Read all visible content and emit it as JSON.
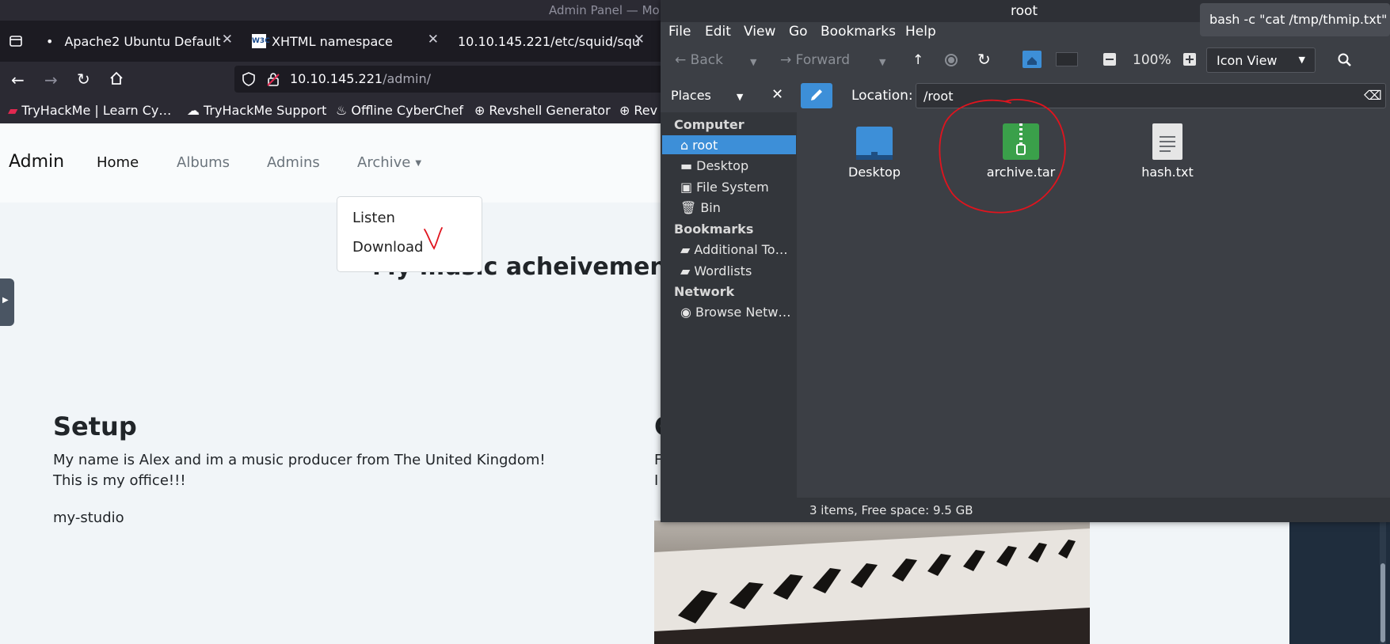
{
  "browser": {
    "window_title": "Admin Panel — Mo",
    "tabs": [
      {
        "label": "Apache2 Ubuntu Default",
        "icon": "bullet-icon"
      },
      {
        "label": "XHTML namespace",
        "icon": "w3c-icon"
      },
      {
        "label": "10.10.145.221/etc/squid/squ",
        "icon": ""
      }
    ],
    "url_host": "10.10.145.221",
    "url_path": "/admin/",
    "bookmarks": [
      "TryHackMe | Learn Cy…",
      "TryHackMe Support",
      "Offline CyberChef",
      "Revshell Generator",
      "Rev"
    ]
  },
  "site": {
    "brand": "Admin",
    "nav": [
      "Home",
      "Albums",
      "Admins",
      "Archive"
    ],
    "dropdown": [
      "Listen",
      "Download"
    ],
    "hero_title": "My music acheivements t",
    "setup": {
      "heading": "Setup",
      "line1": "My name is Alex and im a music producer from The United Kingdom!",
      "line2": "This is my office!!!",
      "tag": "my-studio"
    },
    "col2": {
      "heading": "C",
      "line1": "F",
      "line2": "I"
    }
  },
  "file_manager": {
    "title": "root",
    "tooltip": "bash -c \"cat /tmp/thmip.txt\"",
    "menu": [
      "File",
      "Edit",
      "View",
      "Go",
      "Bookmarks",
      "Help"
    ],
    "toolbar": {
      "back": "Back",
      "forward": "Forward",
      "zoom": "100%",
      "view": "Icon View"
    },
    "places_label": "Places",
    "location_label": "Location:",
    "location": "/root",
    "sidebar": {
      "computer_heading": "Computer",
      "computer_items": [
        "root",
        "Desktop",
        "File System",
        "Bin"
      ],
      "bookmarks_heading": "Bookmarks",
      "bookmark_items": [
        "Additional To…",
        "Wordlists"
      ],
      "network_heading": "Network",
      "network_items": [
        "Browse Netw…"
      ]
    },
    "files": [
      {
        "name": "Desktop",
        "icon": "folder-icon"
      },
      {
        "name": "archive.tar",
        "icon": "archive-icon"
      },
      {
        "name": "hash.txt",
        "icon": "text-file-icon"
      }
    ],
    "status": "3 items, Free space: 9.5 GB"
  },
  "annotation_color": "#e0141e"
}
